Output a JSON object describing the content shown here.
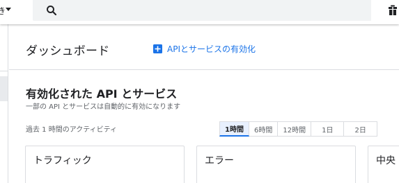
{
  "topbar": {
    "project_suffix": "き",
    "search_icon": "search-icon",
    "right_icon": "gift-icon"
  },
  "header": {
    "title": "ダッシュボード",
    "enable_link": "APIとサービスの有効化",
    "enable_icon": "add-box-icon"
  },
  "section": {
    "title": "有効化された API とサービス",
    "subtitle": "一部の API とサービスは自動的に有効になります"
  },
  "activity": {
    "label": "過去 1 時間のアクティビティ",
    "ranges": [
      "1時間",
      "6時間",
      "12時間",
      "1日",
      "2日"
    ],
    "selected_range": "1時間"
  },
  "cards": {
    "traffic": "トラフィック",
    "errors": "エラー",
    "latency": "中央"
  },
  "colors": {
    "accent": "#1a73e8",
    "text": "#202124",
    "secondary_text": "#5f6368",
    "border": "#dadce0"
  }
}
